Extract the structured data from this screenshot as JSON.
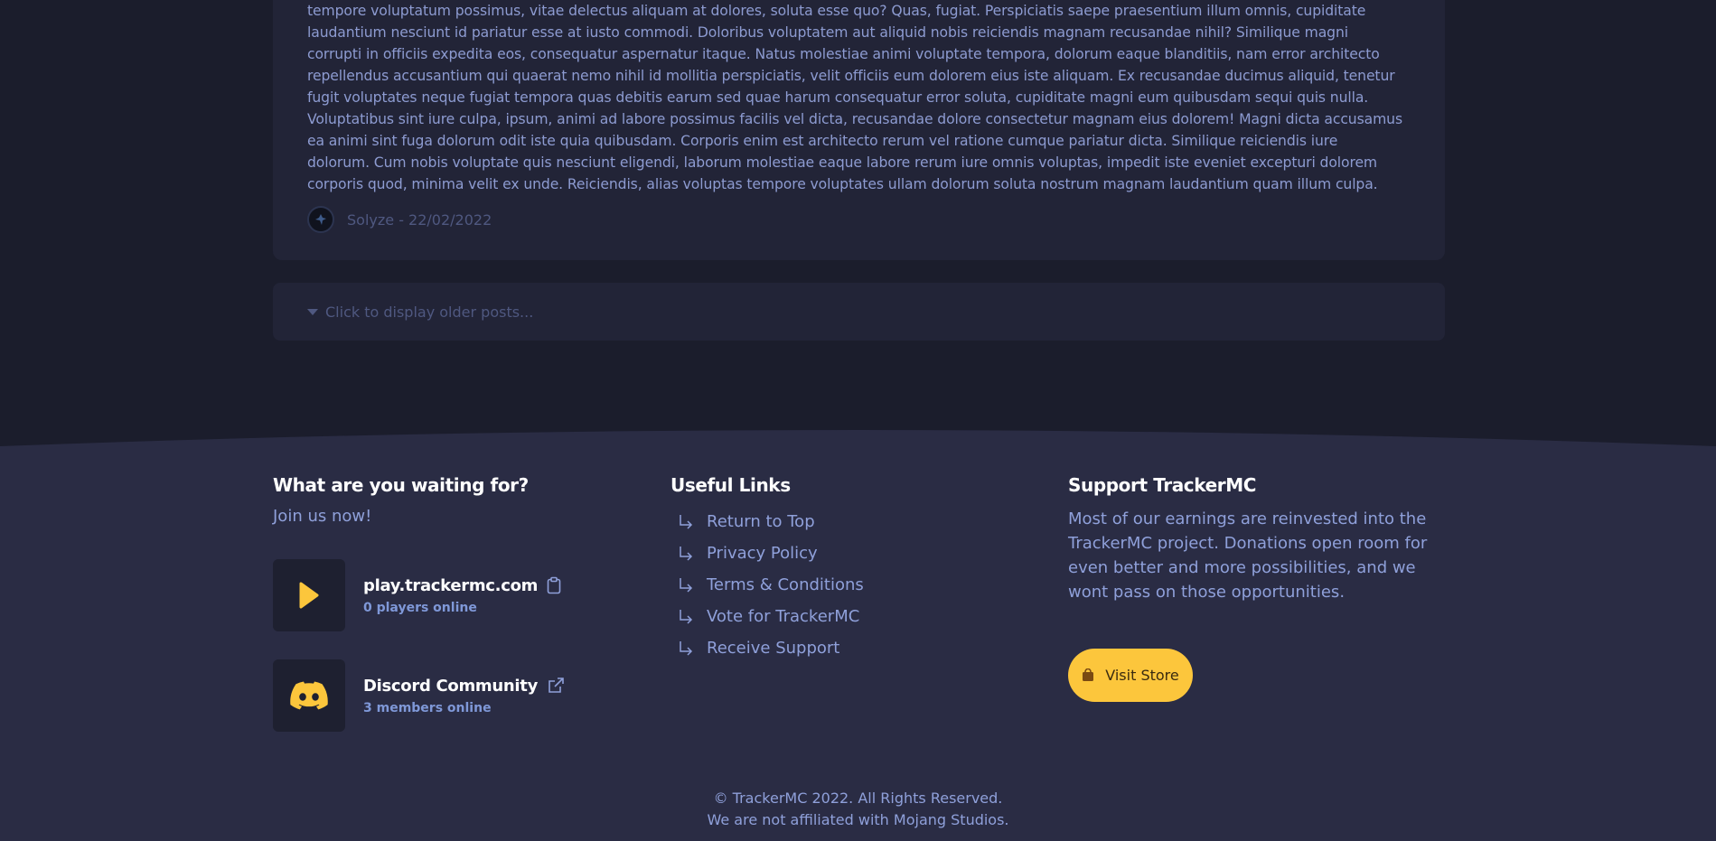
{
  "post": {
    "body": "tempore voluptatum possimus, vitae delectus aliquam at dolores, soluta esse quo? Quas, fugiat. Perspiciatis saepe praesentium illum omnis, cupiditate laudantium nesciunt id pariatur esse at iusto commodi. Doloribus voluptatem aut aliquid nobis reiciendis magnam recusandae nihil? Similique magni corrupti in officiis expedita eos, consequatur aspernatur itaque. Natus molestiae animi voluptate tempora, dolorum eaque blanditiis, nam error architecto repellendus accusantium qui quaerat nemo nihil id mollitia perspiciatis, velit officiis eum dolorem eius iste aliquam. Ex recusandae ducimus aliquid, tenetur fugit voluptates neque fugiat tempora quas debitis earum sed quae harum consequatur error soluta, cupiditate magni eum quibusdam sequi quis nulla. Voluptatibus sint iure culpa, ipsum, animi ad labore possimus facilis vel dicta, recusandae dolore consectetur magnam eius dolorem! Magni dicta accusamus ea animi sint fuga dolorum odit iste quia quibusdam. Corporis enim est architecto rerum vel ratione cumque pariatur dicta. Similique reiciendis iure dolorum. Cum nobis voluptate quis nesciunt eligendi, laborum molestiae eaque labore rerum iure omnis voluptas, impedit iste eveniet excepturi dolorem corporis quod, minima velit ex unde. Reiciendis, alias voluptas tempore voluptates ullam dolorum soluta nostrum magnam laudantium quam illum culpa.",
    "author_line": "Solyze - 22/02/2022"
  },
  "older_posts_label": "Click to display older posts...",
  "footer": {
    "join": {
      "heading": "What are you waiting for?",
      "subtitle": "Join us now!",
      "server_address": "play.trackermc.com",
      "server_status": "0 players online",
      "discord_label": "Discord Community",
      "discord_status": "3 members online"
    },
    "links": {
      "heading": "Useful Links",
      "items": [
        "Return to Top",
        "Privacy Policy",
        "Terms & Conditions",
        "Vote for TrackerMC",
        "Receive Support"
      ]
    },
    "support": {
      "heading": "Support TrackerMC",
      "text": "Most of our earnings are reinvested into the TrackerMC project. Donations open room for even better and more possibilities, and we wont pass on those opportunities.",
      "store_button": "Visit Store"
    },
    "copyright": "© TrackerMC 2022. All Rights Reserved.",
    "disclaimer": "We are not affiliated with Mojang Studios."
  },
  "colors": {
    "page_bg": "#1b1d2c",
    "card_bg": "#222437",
    "footer_bg": "#2a2c44",
    "accent": "#fcc63c"
  },
  "icons": [
    "play-icon",
    "clipboard-icon",
    "discord-icon",
    "external-link-icon",
    "return-arrow-icon",
    "shopping-bag-icon",
    "caret-down-icon"
  ]
}
